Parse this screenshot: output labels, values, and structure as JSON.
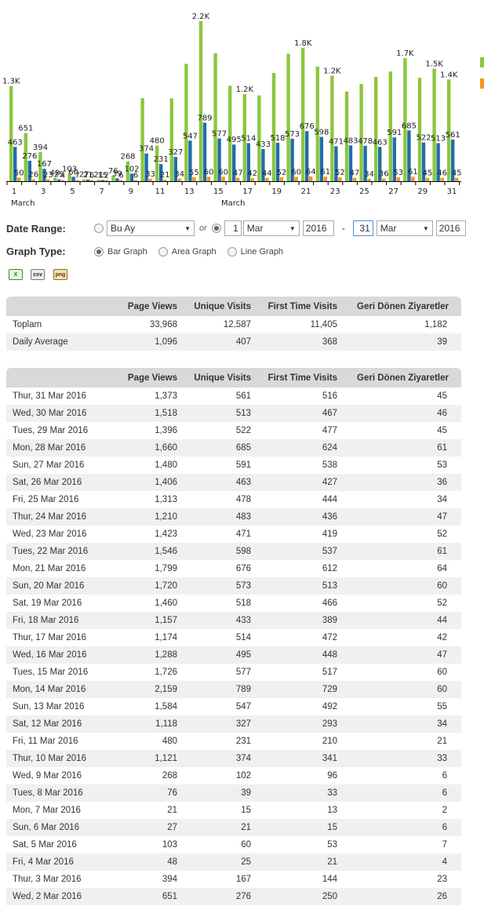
{
  "chart_data": {
    "type": "bar",
    "categories": [
      "1",
      "2",
      "3",
      "4",
      "5",
      "6",
      "7",
      "8",
      "9",
      "10",
      "11",
      "12",
      "13",
      "14",
      "15",
      "16",
      "17",
      "18",
      "19",
      "20",
      "21",
      "22",
      "23",
      "24",
      "25",
      "26",
      "27",
      "28",
      "29",
      "30",
      "31"
    ],
    "x_tick_labels": [
      "1",
      "3",
      "5",
      "7",
      "9",
      "11",
      "13",
      "15",
      "17",
      "19",
      "21",
      "23",
      "25",
      "27",
      "29",
      "31"
    ],
    "x_month_labels": [
      "March",
      "March"
    ],
    "series": [
      {
        "color": "#8cc63f",
        "values": [
          1284,
          651,
          394,
          48,
          103,
          27,
          21,
          76,
          268,
          1121,
          480,
          1118,
          1584,
          2159,
          1726,
          1288,
          1174,
          1157,
          1460,
          1720,
          1799,
          1546,
          1423,
          1210,
          1313,
          1406,
          1480,
          1660,
          1396,
          1518,
          1373
        ],
        "labels": [
          "1.3K",
          "651",
          "394",
          "48",
          "103",
          "27",
          "21",
          "76",
          "268",
          "",
          "480",
          "",
          "",
          "2.2K",
          "",
          "",
          "1.2K",
          "",
          "",
          "",
          "1.8K",
          "",
          "1.2K",
          "",
          "",
          "",
          "",
          "1.7K",
          "",
          "1.5K",
          "1.4K"
        ]
      },
      {
        "color": "#1f6eab",
        "values": [
          463,
          276,
          167,
          25,
          60,
          21,
          15,
          39,
          102,
          374,
          231,
          327,
          547,
          789,
          577,
          495,
          514,
          433,
          518,
          573,
          676,
          598,
          471,
          483,
          478,
          463,
          591,
          685,
          522,
          513,
          561
        ],
        "labels": [
          "463",
          "276",
          "167",
          "25",
          "60",
          "21",
          "15",
          "39",
          "102",
          "374",
          "231",
          "327",
          "547",
          "789",
          "577",
          "495",
          "514",
          "433",
          "518",
          "573",
          "676",
          "598",
          "471",
          "483",
          "478",
          "463",
          "591",
          "685",
          "522",
          "513",
          "561"
        ]
      },
      {
        "color": "#f7941d",
        "values": [
          50,
          26,
          23,
          4,
          7,
          6,
          2,
          6,
          6,
          33,
          21,
          34,
          55,
          60,
          60,
          47,
          42,
          44,
          52,
          60,
          64,
          61,
          52,
          47,
          34,
          36,
          53,
          61,
          45,
          46,
          45
        ],
        "labels": [
          "50",
          "26",
          "23",
          "4",
          "7",
          "6",
          "2",
          "6",
          "6",
          "33",
          "21",
          "34",
          "55",
          "60",
          "60",
          "47",
          "42",
          "44",
          "52",
          "60",
          "64",
          "61",
          "52",
          "47",
          "34",
          "36",
          "53",
          "61",
          "45",
          "46",
          "45"
        ]
      }
    ],
    "ylim": [
      0,
      2250
    ],
    "legend_colors": [
      "#8cc63f",
      "#f7941d"
    ]
  },
  "controls": {
    "date_range_label": "Date Range:",
    "period_select": "Bu Ay",
    "or_text": "or",
    "from_day": "1",
    "from_month": "Mar",
    "from_year": "2016",
    "dash": "-",
    "to_day": "31",
    "to_month": "Mar",
    "to_year": "2016",
    "graph_type_label": "Graph Type:",
    "graph_types": [
      "Bar Graph",
      "Area Graph",
      "Line Graph"
    ]
  },
  "exports": [
    "excel-icon",
    "csv-icon",
    "png-icon"
  ],
  "export_labels": {
    "csv": "csv",
    "png": "png"
  },
  "colors": {
    "header_bg": "#d9d9d9",
    "alt_row": "#f0f0f0"
  },
  "headers": [
    "",
    "Page Views",
    "Unique Visits",
    "First Time Visits",
    "Geri Dönen Ziyaretler"
  ],
  "summary": [
    [
      "Toplam",
      "33,968",
      "12,587",
      "11,405",
      "1,182"
    ],
    [
      "Daily Average",
      "1,096",
      "407",
      "368",
      "39"
    ]
  ],
  "daily": [
    [
      "Thur, 31 Mar 2016",
      "1,373",
      "561",
      "516",
      "45"
    ],
    [
      "Wed, 30 Mar 2016",
      "1,518",
      "513",
      "467",
      "46"
    ],
    [
      "Tues, 29 Mar 2016",
      "1,396",
      "522",
      "477",
      "45"
    ],
    [
      "Mon, 28 Mar 2016",
      "1,660",
      "685",
      "624",
      "61"
    ],
    [
      "Sun, 27 Mar 2016",
      "1,480",
      "591",
      "538",
      "53"
    ],
    [
      "Sat, 26 Mar 2016",
      "1,406",
      "463",
      "427",
      "36"
    ],
    [
      "Fri, 25 Mar 2016",
      "1,313",
      "478",
      "444",
      "34"
    ],
    [
      "Thur, 24 Mar 2016",
      "1,210",
      "483",
      "436",
      "47"
    ],
    [
      "Wed, 23 Mar 2016",
      "1,423",
      "471",
      "419",
      "52"
    ],
    [
      "Tues, 22 Mar 2016",
      "1,546",
      "598",
      "537",
      "61"
    ],
    [
      "Mon, 21 Mar 2016",
      "1,799",
      "676",
      "612",
      "64"
    ],
    [
      "Sun, 20 Mar 2016",
      "1,720",
      "573",
      "513",
      "60"
    ],
    [
      "Sat, 19 Mar 2016",
      "1,460",
      "518",
      "466",
      "52"
    ],
    [
      "Fri, 18 Mar 2016",
      "1,157",
      "433",
      "389",
      "44"
    ],
    [
      "Thur, 17 Mar 2016",
      "1,174",
      "514",
      "472",
      "42"
    ],
    [
      "Wed, 16 Mar 2016",
      "1,288",
      "495",
      "448",
      "47"
    ],
    [
      "Tues, 15 Mar 2016",
      "1,726",
      "577",
      "517",
      "60"
    ],
    [
      "Mon, 14 Mar 2016",
      "2,159",
      "789",
      "729",
      "60"
    ],
    [
      "Sun, 13 Mar 2016",
      "1,584",
      "547",
      "492",
      "55"
    ],
    [
      "Sat, 12 Mar 2016",
      "1,118",
      "327",
      "293",
      "34"
    ],
    [
      "Fri, 11 Mar 2016",
      "480",
      "231",
      "210",
      "21"
    ],
    [
      "Thur, 10 Mar 2016",
      "1,121",
      "374",
      "341",
      "33"
    ],
    [
      "Wed, 9 Mar 2016",
      "268",
      "102",
      "96",
      "6"
    ],
    [
      "Tues, 8 Mar 2016",
      "76",
      "39",
      "33",
      "6"
    ],
    [
      "Mon, 7 Mar 2016",
      "21",
      "15",
      "13",
      "2"
    ],
    [
      "Sun, 6 Mar 2016",
      "27",
      "21",
      "15",
      "6"
    ],
    [
      "Sat, 5 Mar 2016",
      "103",
      "60",
      "53",
      "7"
    ],
    [
      "Fri, 4 Mar 2016",
      "48",
      "25",
      "21",
      "4"
    ],
    [
      "Thur, 3 Mar 2016",
      "394",
      "167",
      "144",
      "23"
    ],
    [
      "Wed, 2 Mar 2016",
      "651",
      "276",
      "250",
      "26"
    ]
  ]
}
